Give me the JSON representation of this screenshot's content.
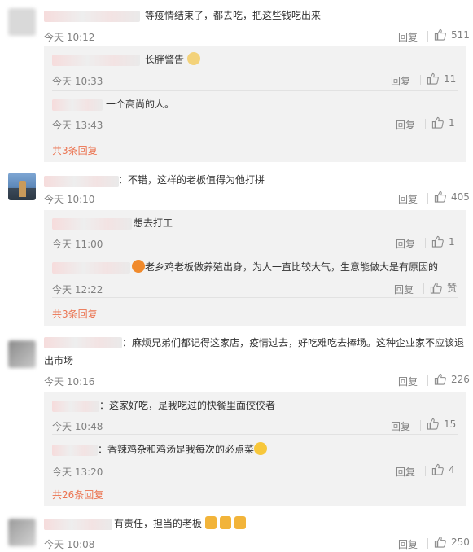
{
  "comments": [
    {
      "text": "等疫情结束了，都去吃，把这些钱吃出来",
      "time": "今天 10:12",
      "reply": "回复",
      "likes": "511",
      "replies": [
        {
          "text": "长胖警告",
          "time": "今天 10:33",
          "reply": "回复",
          "likes": "11",
          "emoji": "dog-face-emoji"
        },
        {
          "text": "一个高尚的人。",
          "time": "今天 13:43",
          "reply": "回复",
          "likes": "1"
        }
      ],
      "more": "共3条回复"
    },
    {
      "text": "：不错，这样的老板值得为他打拼",
      "time": "今天 10:10",
      "reply": "回复",
      "likes": "405",
      "replies": [
        {
          "text": "想去打工",
          "time": "今天 11:00",
          "reply": "回复",
          "likes": "1"
        },
        {
          "text": "老乡鸡老板做养殖出身，为人一直比较大气，生意能做大是有原因的",
          "time": "今天 12:22",
          "reply": "回复",
          "likes": "赞",
          "emoji": "laughing-emoji"
        }
      ],
      "more": "共3条回复"
    },
    {
      "text": "：麻烦兄弟们都记得这家店，疫情过去，好吃难吃去捧场。这种企业家不应该退出市场",
      "time": "今天 10:16",
      "reply": "回复",
      "likes": "226",
      "replies": [
        {
          "text": "：这家好吃，是我吃过的快餐里面佼佼者",
          "time": "今天 10:48",
          "reply": "回复",
          "likes": "15"
        },
        {
          "text": "：香辣鸡杂和鸡汤是我每次的必点菜",
          "time": "今天 13:20",
          "reply": "回复",
          "likes": "4",
          "emoji": "grin-emoji"
        }
      ],
      "more": "共26条回复"
    },
    {
      "text": "有责任，担当的老板",
      "time": "今天 10:08",
      "reply": "回复",
      "likes": "250",
      "emoji": "thumbs-up-emoji"
    }
  ],
  "colors": {
    "link": "#eb7350",
    "muted": "#808080",
    "subbg": "#f2f2f2"
  },
  "icons": {
    "like": "thumbs-up-outline-icon"
  }
}
